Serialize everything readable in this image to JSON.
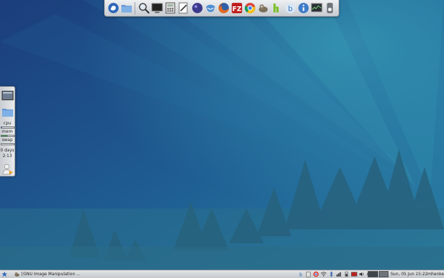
{
  "desktop": {
    "colors": {
      "sky_dark": "#1a3f7e",
      "sky_light": "#2b8fb0",
      "ground": "#2a6a86",
      "tree": "#27607c"
    }
  },
  "top_dock": {
    "launchers": [
      {
        "icon": "xfce-mouse-menu-icon"
      },
      {
        "icon": "file-manager-folder-icon"
      },
      {
        "icon": "search-magnifier-icon"
      },
      {
        "icon": "terminal-icon"
      },
      {
        "icon": "calculator-icon"
      },
      {
        "icon": "text-editor-icon"
      },
      {
        "icon": "media-player-icon"
      },
      {
        "icon": "thunderbird-mail-icon"
      },
      {
        "icon": "firefox-icon"
      },
      {
        "icon": "filezilla-icon"
      },
      {
        "icon": "chrome-icon"
      },
      {
        "icon": "gimp-icon"
      },
      {
        "icon": "hypnotix-icon"
      },
      {
        "icon": "bittorrent-icon"
      },
      {
        "icon": "info-icon"
      },
      {
        "icon": "system-monitor-icon"
      },
      {
        "icon": "switch-icon"
      }
    ],
    "filezilla_label": "FZ"
  },
  "left_panel": {
    "sysload": {
      "cpu_label": "cpu",
      "mem_label": "mem",
      "swap_label": "swap",
      "cpu": 0.1,
      "mem": 0.55,
      "swap": 0.0
    },
    "uptime_days": "0 days",
    "uptime_time": "2:13"
  },
  "taskbar": {
    "task_title": "[GNU Image Manipulation ...",
    "clock": "Sun, 05 Jun  15:22",
    "username": "mhenke"
  }
}
